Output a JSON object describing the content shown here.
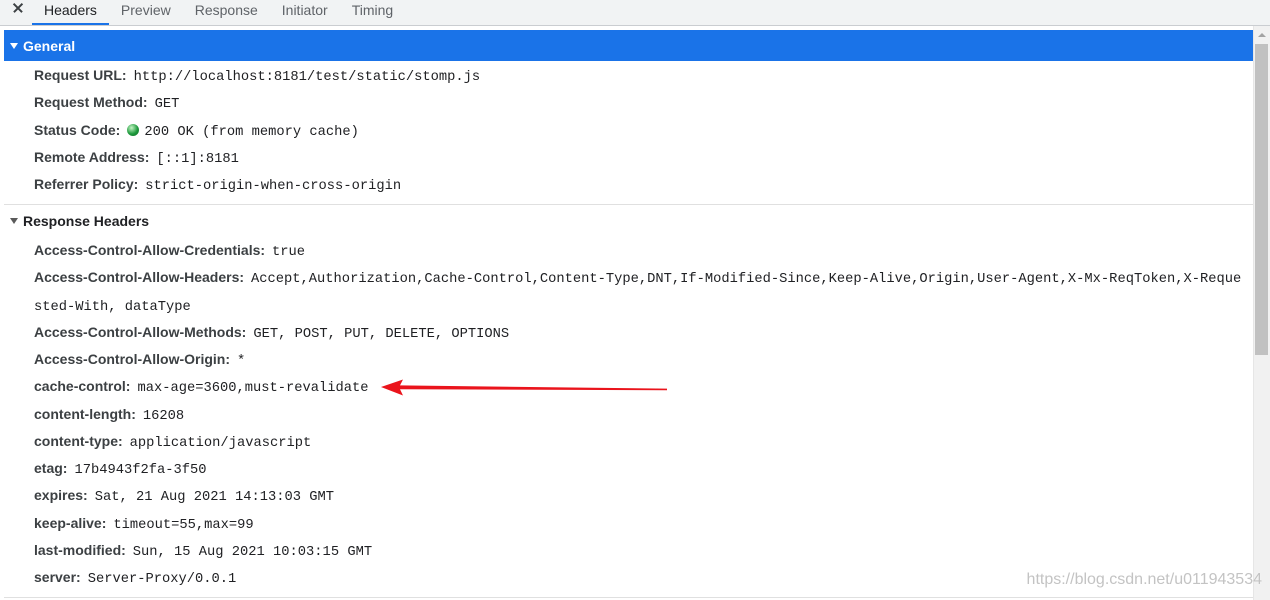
{
  "tabs": [
    {
      "label": "Headers",
      "active": true
    },
    {
      "label": "Preview",
      "active": false
    },
    {
      "label": "Response",
      "active": false
    },
    {
      "label": "Initiator",
      "active": false
    },
    {
      "label": "Timing",
      "active": false
    }
  ],
  "general": {
    "title": "General",
    "expanded": true,
    "selected": true,
    "rows": [
      {
        "name": "Request URL:",
        "value": "http://localhost:8181/test/static/stomp.js"
      },
      {
        "name": "Request Method:",
        "value": "GET"
      },
      {
        "name": "Status Code:",
        "value": "200 OK (from memory cache)",
        "icon": "green-status-dot-icon"
      },
      {
        "name": "Remote Address:",
        "value": "[::1]:8181"
      },
      {
        "name": "Referrer Policy:",
        "value": "strict-origin-when-cross-origin"
      }
    ]
  },
  "response_headers": {
    "title": "Response Headers",
    "expanded": true,
    "selected": false,
    "rows": [
      {
        "name": "Access-Control-Allow-Credentials:",
        "value": "true"
      },
      {
        "name": "Access-Control-Allow-Headers:",
        "value": "Accept,Authorization,Cache-Control,Content-Type,DNT,If-Modified-Since,Keep-Alive,Origin,User-Agent,X-Mx-ReqToken,X-Requested-With, dataType"
      },
      {
        "name": "Access-Control-Allow-Methods:",
        "value": "GET, POST, PUT, DELETE, OPTIONS"
      },
      {
        "name": "Access-Control-Allow-Origin:",
        "value": "*"
      },
      {
        "name": "cache-control:",
        "value": "max-age=3600,must-revalidate"
      },
      {
        "name": "content-length:",
        "value": "16208"
      },
      {
        "name": "content-type:",
        "value": "application/javascript"
      },
      {
        "name": "etag:",
        "value": "17b4943f2fa-3f50"
      },
      {
        "name": "expires:",
        "value": "Sat, 21 Aug 2021 14:13:03 GMT"
      },
      {
        "name": "keep-alive:",
        "value": "timeout=55,max=99"
      },
      {
        "name": "last-modified:",
        "value": "Sun, 15 Aug 2021 10:03:15 GMT"
      },
      {
        "name": "server:",
        "value": "Server-Proxy/0.0.1"
      }
    ]
  },
  "icons": {
    "close": "close-icon",
    "section_toggle": "triangle-down-icon",
    "scroll_up": "scroll-up-arrow-icon",
    "annotation": "red-arrow"
  },
  "colors": {
    "accent": "#1a73e8",
    "status_ok": "#1e9a3d",
    "annotation": "#ea141c"
  },
  "watermark": "https://blog.csdn.net/u011943534"
}
